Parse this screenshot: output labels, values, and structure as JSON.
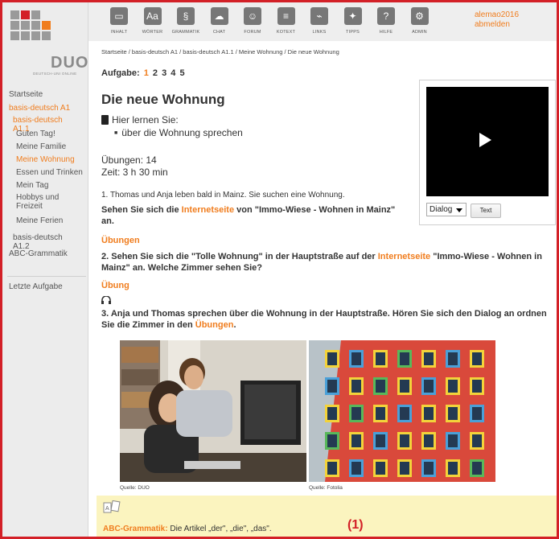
{
  "logo": {
    "text": "DUO",
    "subtitle": "DEUTSCH-UNI ONLINE"
  },
  "sidebar": {
    "items": [
      {
        "label": "Startseite",
        "indent": 0,
        "orange": false
      },
      {
        "label": "basis-deutsch A1",
        "indent": 0,
        "orange": true
      },
      {
        "label": "basis-deutsch A1.1",
        "indent": 1,
        "orange": true
      },
      {
        "label": "Guten Tag!",
        "indent": 2,
        "orange": false
      },
      {
        "label": "Meine Familie",
        "indent": 2,
        "orange": false
      },
      {
        "label": "Meine Wohnung",
        "indent": 2,
        "orange": true
      },
      {
        "label": "Essen und Trinken",
        "indent": 2,
        "orange": false
      },
      {
        "label": "Mein Tag",
        "indent": 2,
        "orange": false
      },
      {
        "label": "Hobbys und Freizeit",
        "indent": 2,
        "orange": false
      },
      {
        "label": "Meine Ferien",
        "indent": 2,
        "orange": false
      },
      {
        "label": "basis-deutsch A1.2",
        "indent": 1,
        "orange": false
      },
      {
        "label": "ABC-Grammatik",
        "indent": 0,
        "orange": false
      },
      {
        "label": "Letzte Aufgabe",
        "indent": 0,
        "orange": false
      }
    ]
  },
  "toolbar": {
    "items": [
      {
        "label": "INHALT",
        "icon": "folder-icon",
        "glyph": "▭"
      },
      {
        "label": "WÖRTER",
        "icon": "dictionary-icon",
        "glyph": "Aa"
      },
      {
        "label": "GRAMMATIK",
        "icon": "grammar-icon",
        "glyph": "§"
      },
      {
        "label": "CHAT",
        "icon": "chat-icon",
        "glyph": "☁"
      },
      {
        "label": "FORUM",
        "icon": "forum-icon",
        "glyph": "☺"
      },
      {
        "label": "KOTEXT",
        "icon": "kotext-icon",
        "glyph": "≡"
      },
      {
        "label": "LINKS",
        "icon": "links-icon",
        "glyph": "⌁"
      },
      {
        "label": "TIPPS",
        "icon": "lightbulb-icon",
        "glyph": "✦"
      },
      {
        "label": "HILFE",
        "icon": "help-icon",
        "glyph": "?"
      },
      {
        "label": "ADMIN",
        "icon": "gears-icon",
        "glyph": "⚙"
      }
    ],
    "user": "alemao2016",
    "logout": "abmelden"
  },
  "breadcrumb": "Startseite / basis-deutsch A1 / basis-deutsch A1.1 / Meine Wohnung / Die neue Wohnung",
  "aufgabe": {
    "label": "Aufgabe:",
    "pages": [
      "1",
      "2",
      "3",
      "4",
      "5"
    ],
    "active": "1"
  },
  "title": "Die neue Wohnung",
  "learn": {
    "heading": "Hier lernen Sie:",
    "item": "über die Wohnung sprechen"
  },
  "meta": {
    "uebungen": "Übungen: 14",
    "zeit": "Zeit: 3 h 30 min"
  },
  "task1": {
    "text": "1. Thomas und Anja leben bald in Mainz. Sie suchen eine Wohnung."
  },
  "task1b": {
    "pre": "Sehen Sie sich die ",
    "link": "Internetseite",
    "post": " von \"Immo-Wiese - Wohnen in Mainz\" an."
  },
  "link_uebungen": "Übungen",
  "task2": {
    "pre": "2. Sehen Sie sich die \"Tolle Wohnung\" in der Hauptstraße auf der ",
    "link": "Internetseite",
    "post": " \"Immo-Wiese - Wohnen in Mainz\" an. Welche Zimmer sehen Sie?"
  },
  "link_uebung": "Übung",
  "task3": {
    "pre": "3. Anja und Thomas sprechen über die Wohnung in der Hauptstraße. Hören Sie sich den Dialog an ordnen Sie die Zimmer in den ",
    "link": "Übungen",
    "post": "."
  },
  "video": {
    "select": "Dialog",
    "text_button": "Text"
  },
  "images": {
    "source1": "Quelle: DUO",
    "source2": "Quelle: Fotolia"
  },
  "footer": {
    "link": "ABC-Grammatik:",
    "text": " Die Artikel „der\", „die\", „das\".",
    "annotation": "(1)"
  },
  "colors": {
    "accent": "#f07d1e",
    "frame": "#d32027",
    "footer_bg": "#fbf4bf"
  }
}
